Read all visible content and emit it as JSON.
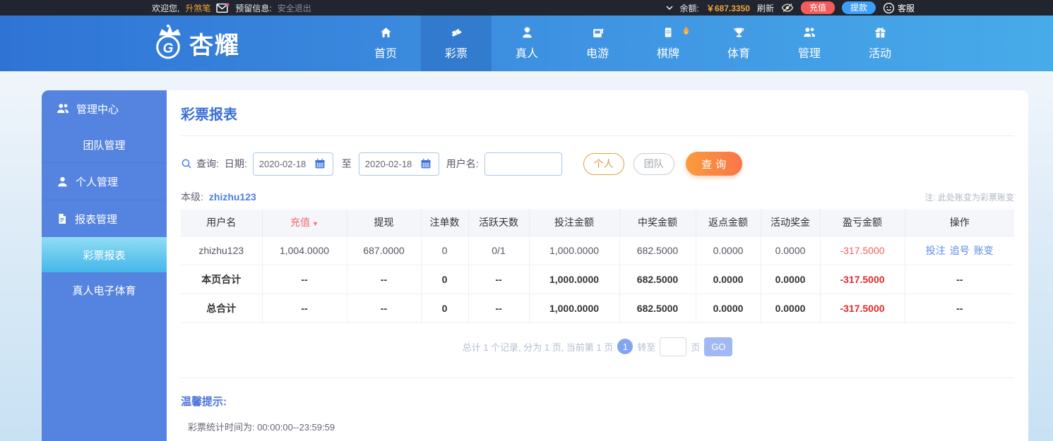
{
  "topbar": {
    "welcome": "欢迎您,",
    "username": "升煞笔",
    "reserved_label": "预留信息:",
    "logout": "安全退出",
    "balance_label": "余额:",
    "balance": "￥687.3350",
    "refresh": "刷新",
    "recharge": "充值",
    "withdraw": "提款",
    "service": "客服"
  },
  "nav": {
    "brand": "杏耀",
    "items": [
      {
        "id": "home",
        "label": "首页",
        "icon": "home-icon",
        "active": false,
        "hot": false
      },
      {
        "id": "lottery",
        "label": "彩票",
        "icon": "ticket-icon",
        "active": true,
        "hot": false
      },
      {
        "id": "live",
        "label": "真人",
        "icon": "person-icon",
        "active": false,
        "hot": false
      },
      {
        "id": "egame",
        "label": "电游",
        "icon": "slot-icon",
        "active": false,
        "hot": false
      },
      {
        "id": "board",
        "label": "棋牌",
        "icon": "tile-icon",
        "active": false,
        "hot": true
      },
      {
        "id": "sports",
        "label": "体育",
        "icon": "trophy-icon",
        "active": false,
        "hot": false
      },
      {
        "id": "manage",
        "label": "管理",
        "icon": "users-icon",
        "active": false,
        "hot": false
      },
      {
        "id": "activity",
        "label": "活动",
        "icon": "gift-icon",
        "active": false,
        "hot": false
      }
    ]
  },
  "sidebar": {
    "items": [
      {
        "id": "manage-center",
        "label": "管理中心",
        "icon": "users-icon",
        "type": "group",
        "active": false,
        "divider_before": false
      },
      {
        "id": "team-manage",
        "label": "团队管理",
        "icon": "",
        "type": "sub",
        "active": false,
        "divider_before": false
      },
      {
        "id": "personal",
        "label": "个人管理",
        "icon": "user-icon",
        "type": "group",
        "active": false,
        "divider_before": true
      },
      {
        "id": "report-manage",
        "label": "报表管理",
        "icon": "doc-icon",
        "type": "group",
        "active": false,
        "divider_before": true
      },
      {
        "id": "lottery-report",
        "label": "彩票报表",
        "icon": "",
        "type": "sub",
        "active": true,
        "divider_before": false
      },
      {
        "id": "live-esports",
        "label": "真人电子体育",
        "icon": "",
        "type": "sub",
        "active": false,
        "divider_before": false
      }
    ]
  },
  "main": {
    "title": "彩票报表",
    "search": {
      "query_label": "查询:",
      "date_label": "日期:",
      "date_from": "2020-02-18",
      "to_label": "至",
      "date_to": "2020-02-18",
      "username_label": "用户名:",
      "username_value": "",
      "personal_btn": "个人",
      "team_btn": "团队",
      "search_btn": "查询"
    },
    "level_label": "本级:",
    "level_user": "zhizhu123",
    "note": "注: 此处账变为彩票账变",
    "table": {
      "headers": [
        "用户名",
        "充值",
        "提现",
        "注单数",
        "活跃天数",
        "投注金额",
        "中奖金额",
        "返点金额",
        "活动奖金",
        "盈亏金额",
        "操作"
      ],
      "sort_column_index": 1,
      "sort_indicator": "▼",
      "rows": [
        {
          "cells": [
            "zhizhu123",
            "1,004.0000",
            "687.0000",
            "0",
            "0/1",
            "1,000.0000",
            "682.5000",
            "0.0000",
            "0.0000",
            "-317.5000"
          ],
          "actions": [
            "投注",
            "追号",
            "账变"
          ],
          "actions_text": "",
          "bold": false
        },
        {
          "cells": [
            "本页合计",
            "--",
            "--",
            "0",
            "--",
            "1,000.0000",
            "682.5000",
            "0.0000",
            "0.0000",
            "-317.5000"
          ],
          "actions": [],
          "actions_text": "--",
          "bold": true
        },
        {
          "cells": [
            "总合计",
            "--",
            "--",
            "0",
            "--",
            "1,000.0000",
            "682.5000",
            "0.0000",
            "0.0000",
            "-317.5000"
          ],
          "actions": [],
          "actions_text": "--",
          "bold": true
        }
      ]
    },
    "pagination": {
      "summary": "总计 1 个记录, 分为 1 页, 当前第 1 页",
      "current_page": "1",
      "goto_label": "转至",
      "goto_value": "",
      "page_unit": "页",
      "go_label": "GO"
    },
    "tips": {
      "title": "温馨提示:",
      "content": "彩票统计时间为: 00:00:00--23:59:59"
    }
  },
  "colors": {
    "accent_orange": "#f59a23",
    "recharge_red": "#f25c5c",
    "withdraw_blue": "#3d9ef5",
    "link_blue": "#5a8ee8",
    "loss_red": "#e02b2b",
    "sort_red": "#f56c6c",
    "nav_blue_start": "#2f74d5",
    "nav_blue_end": "#47abe9",
    "sidebar_blue": "#5584e0",
    "sidebar_active_cyan": "#45b6ea",
    "title_blue": "#3a6fd8"
  }
}
